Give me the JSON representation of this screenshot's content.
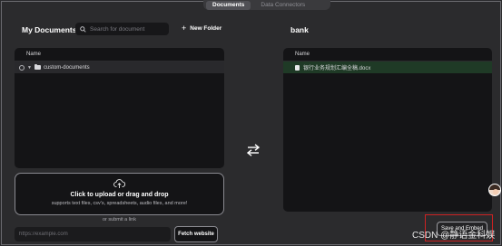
{
  "tabs": [
    {
      "label": "Documents",
      "active": true
    },
    {
      "label": "Data Connectors",
      "active": false
    }
  ],
  "left": {
    "title": "My Documents",
    "search_placeholder": "Search for document",
    "new_folder_label": "New Folder",
    "table_header": "Name",
    "items": [
      {
        "name": "custom-documents",
        "type": "folder"
      }
    ]
  },
  "right": {
    "title": "bank",
    "table_header": "Name",
    "items": [
      {
        "name": "银行业务规划汇编全稿.docx",
        "type": "file"
      }
    ]
  },
  "upload": {
    "title": "Click to upload or drag and drop",
    "subtitle": "supports text files, csv's, spreadsheets, audio files, and more!",
    "or_text": "or submit a link",
    "link_placeholder": "https://example.com",
    "fetch_label": "Fetch website"
  },
  "save_embed_label": "Save and Embed",
  "watermark": "CSDN @静语金科娱",
  "icons": {
    "search": "search-icon",
    "swap": "swap-arrows-icon",
    "upload": "cloud-upload-icon",
    "folder": "folder-icon",
    "file": "file-icon"
  },
  "colors": {
    "background": "#2b2b2d",
    "panel": "#141416",
    "selected_row": "#1f3a26",
    "highlight_box": "#cc2222"
  }
}
